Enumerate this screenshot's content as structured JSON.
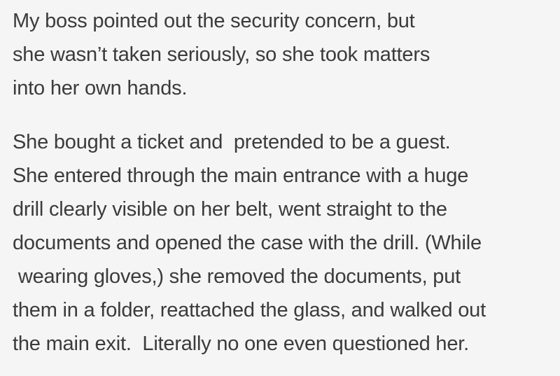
{
  "document": {
    "paragraphs": [
      {
        "lines": [
          "My boss pointed out the security concern, but",
          "she wasn’t taken seriously, so she took matters",
          "into her own hands."
        ]
      },
      {
        "lines": [
          "She bought a ticket and  pretended to be a guest.",
          "She entered through the main entrance with a huge",
          "drill clearly visible on her belt, went straight to the",
          "documents and opened the case with the drill. (While",
          " wearing gloves,) she removed the documents, put",
          "them in a folder, reattached the glass, and walked out",
          "the main exit.  Literally no one even questioned her."
        ]
      }
    ]
  }
}
